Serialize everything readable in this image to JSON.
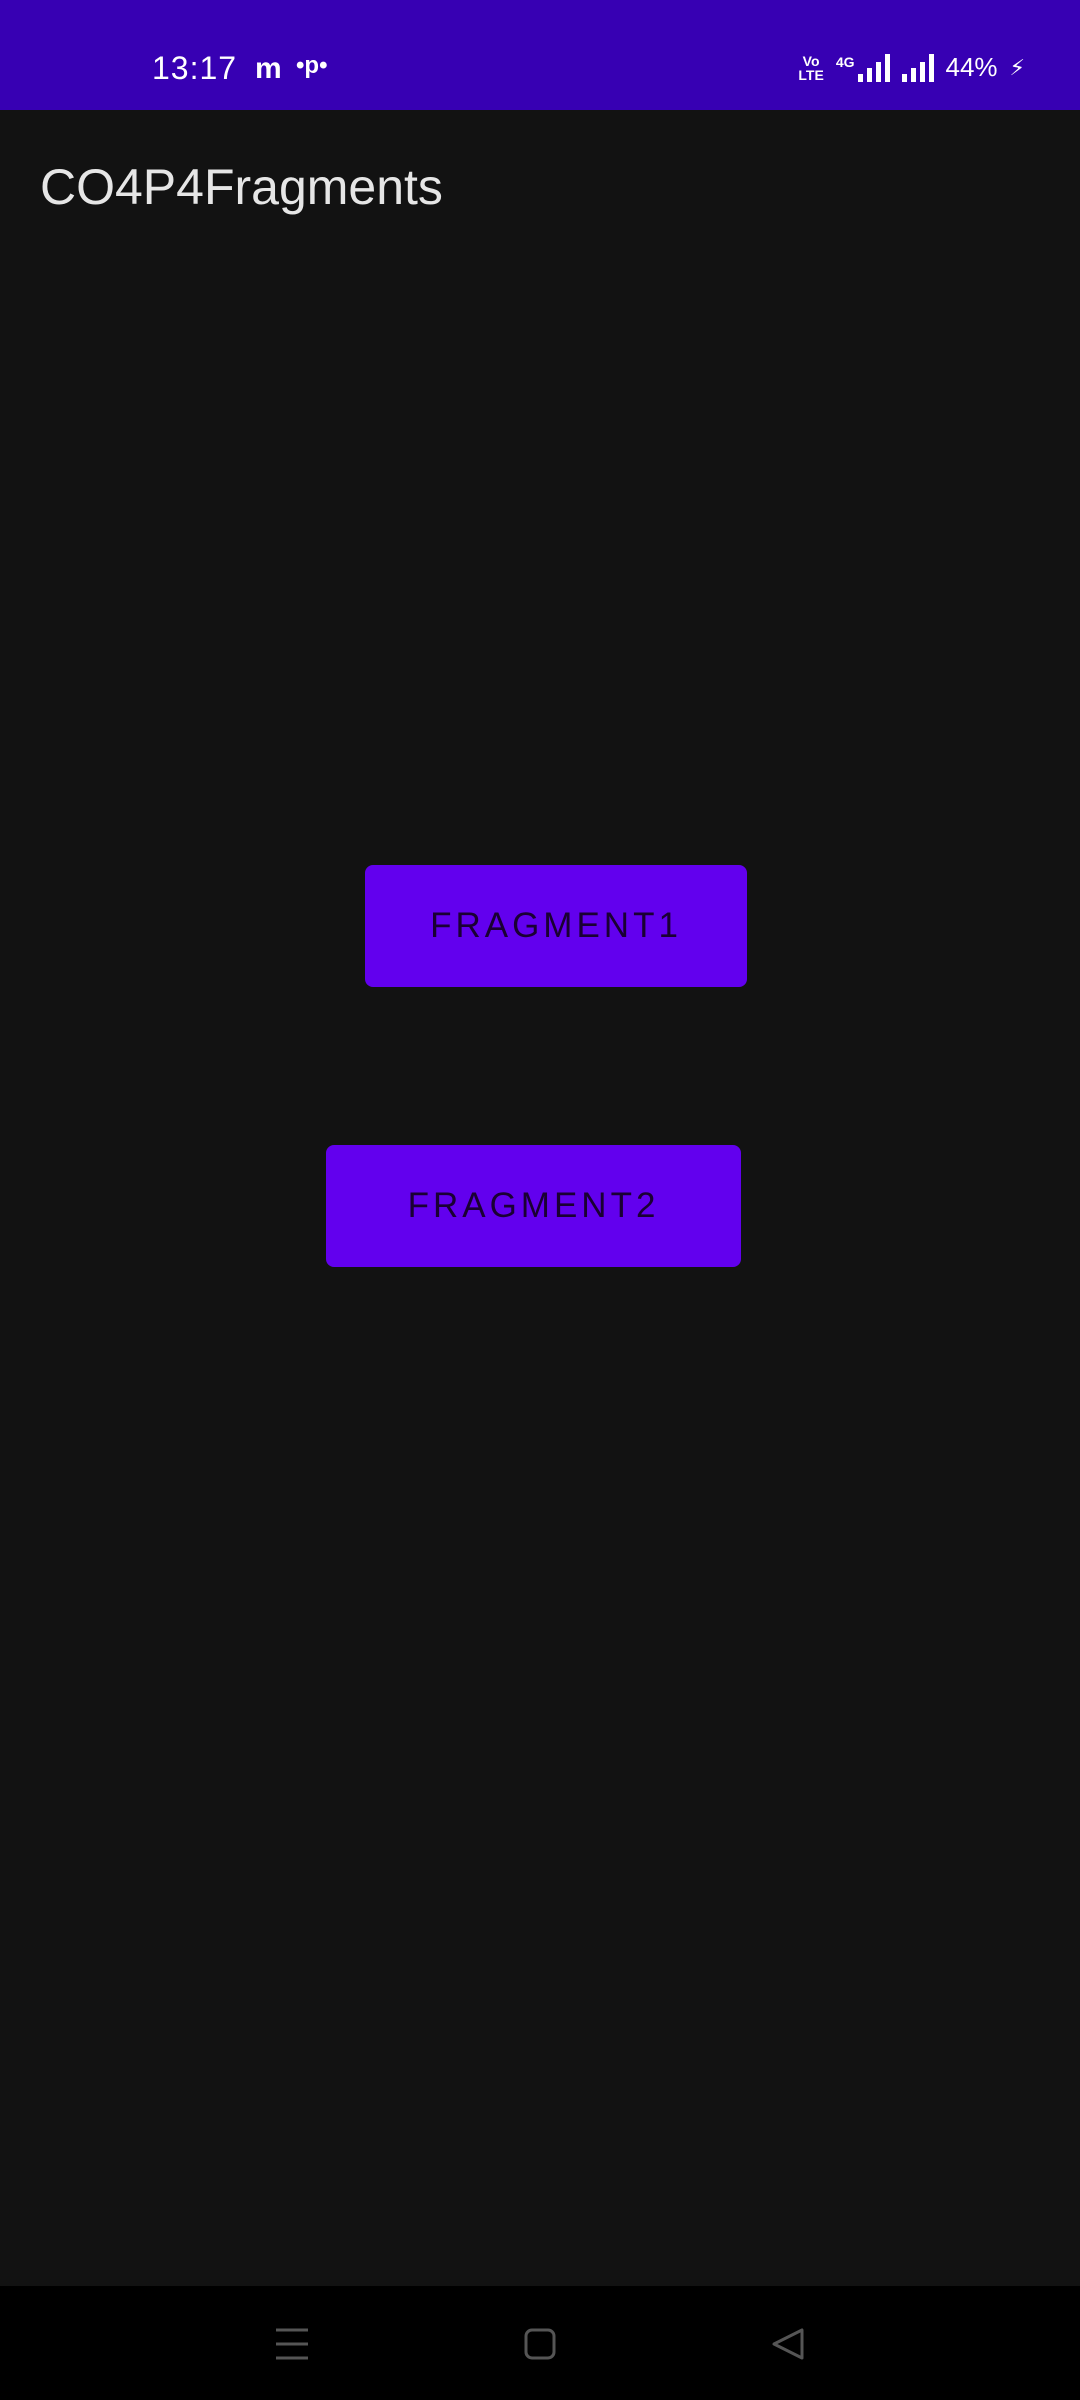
{
  "status_bar": {
    "time": "13:17",
    "notification_icons": [
      "m",
      "•p•"
    ],
    "network_label": "4G",
    "volte_label_top": "Vo",
    "volte_label_bottom": "LTE",
    "battery": "44%",
    "charging_icon": "⚡"
  },
  "app_bar": {
    "title": "CO4P4Fragments"
  },
  "buttons": {
    "fragment1": "FRAGMENT1",
    "fragment2": "FRAGMENT2"
  },
  "colors": {
    "status_bar": "#3700B3",
    "primary": "#6200EE",
    "background": "#121212"
  }
}
